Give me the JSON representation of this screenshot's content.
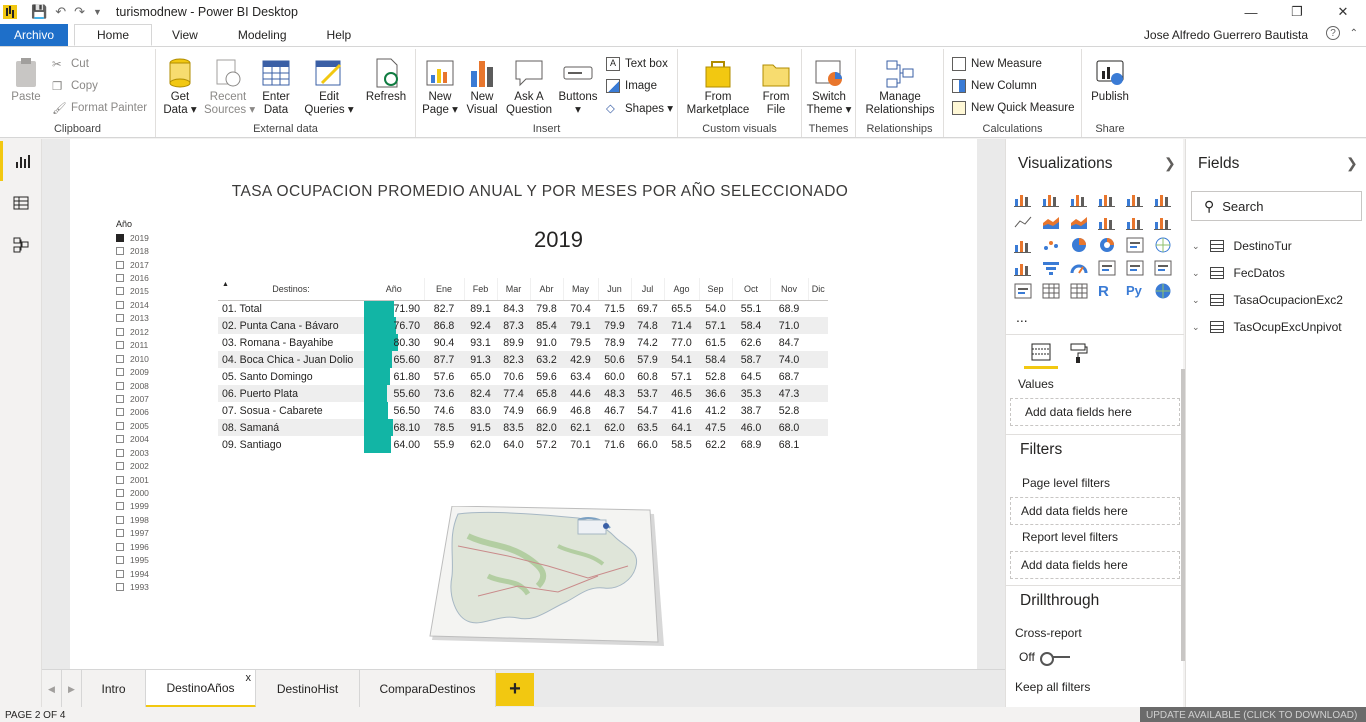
{
  "app": {
    "title": "turismodnew - Power BI Desktop",
    "user": "Jose Alfredo Guerrero Bautista",
    "help": "?"
  },
  "menu_tabs": [
    "Archivo",
    "Home",
    "View",
    "Modeling",
    "Help"
  ],
  "ribbon": {
    "clipboard": {
      "paste": "Paste",
      "cut": "Cut",
      "copy": "Copy",
      "format_painter": "Format Painter",
      "label": "Clipboard"
    },
    "external": {
      "get_data": "Get\nData ▾",
      "recent": "Recent\nSources ▾",
      "enter": "Enter\nData",
      "edit": "Edit\nQueries ▾",
      "refresh": "Refresh",
      "label": "External data"
    },
    "insert": {
      "new_page": "New\nPage ▾",
      "new_visual": "New\nVisual",
      "ask": "Ask A\nQuestion",
      "buttons": "Buttons\n▾",
      "text_box": "Text box",
      "image": "Image",
      "shapes": "Shapes ▾",
      "label": "Insert"
    },
    "custom": {
      "from_market": "From\nMarketplace",
      "from_file": "From\nFile",
      "label": "Custom visuals"
    },
    "themes": {
      "switch": "Switch\nTheme ▾",
      "label": "Themes"
    },
    "relationships": {
      "manage": "Manage\nRelationships",
      "label": "Relationships"
    },
    "calculations": {
      "new_measure": "New Measure",
      "new_column": "New Column",
      "new_quick": "New Quick Measure",
      "label": "Calculations"
    },
    "share": {
      "publish": "Publish",
      "label": "Share"
    }
  },
  "report": {
    "title": "TASA OCUPACION PROMEDIO ANUAL Y POR MESES POR AÑO SELECCIONADO",
    "selected_year": "2019",
    "slicer_header": "Año",
    "years": [
      "2019",
      "2018",
      "2017",
      "2016",
      "2015",
      "2014",
      "2013",
      "2012",
      "2011",
      "2010",
      "2009",
      "2008",
      "2007",
      "2006",
      "2005",
      "2004",
      "2003",
      "2002",
      "2001",
      "2000",
      "1999",
      "1998",
      "1997",
      "1996",
      "1995",
      "1994",
      "1993"
    ],
    "table": {
      "columns": [
        "Destinos:",
        "Año",
        "Ene",
        "Feb",
        "Mar",
        "Abr",
        "May",
        "Jun",
        "Jul",
        "Ago",
        "Sep",
        "Oct",
        "Nov",
        "Dic"
      ],
      "rows": [
        {
          "dest": "01. Total",
          "ano": "71.90",
          "ano_value": 71.9,
          "m": [
            "82.7",
            "89.1",
            "84.3",
            "79.8",
            "70.4",
            "71.5",
            "69.7",
            "65.5",
            "54.0",
            "55.1",
            "68.9",
            ""
          ]
        },
        {
          "dest": "02. Punta Cana - Bávaro",
          "ano": "76.70",
          "ano_value": 76.7,
          "m": [
            "86.8",
            "92.4",
            "87.3",
            "85.4",
            "79.1",
            "79.9",
            "74.8",
            "71.4",
            "57.1",
            "58.4",
            "71.0",
            ""
          ]
        },
        {
          "dest": "03. Romana - Bayahibe",
          "ano": "80.30",
          "ano_value": 80.3,
          "m": [
            "90.4",
            "93.1",
            "89.9",
            "91.0",
            "79.5",
            "78.9",
            "74.2",
            "77.0",
            "61.5",
            "62.6",
            "84.7",
            ""
          ]
        },
        {
          "dest": "04. Boca Chica - Juan Dolio",
          "ano": "65.60",
          "ano_value": 65.6,
          "m": [
            "87.7",
            "91.3",
            "82.3",
            "63.2",
            "42.9",
            "50.6",
            "57.9",
            "54.1",
            "58.4",
            "58.7",
            "74.0",
            ""
          ]
        },
        {
          "dest": "05. Santo Domingo",
          "ano": "61.80",
          "ano_value": 61.8,
          "m": [
            "57.6",
            "65.0",
            "70.6",
            "59.6",
            "63.4",
            "60.0",
            "60.8",
            "57.1",
            "52.8",
            "64.5",
            "68.7",
            ""
          ]
        },
        {
          "dest": "06. Puerto Plata",
          "ano": "55.60",
          "ano_value": 55.6,
          "m": [
            "73.6",
            "82.4",
            "77.4",
            "65.8",
            "44.6",
            "48.3",
            "53.7",
            "46.5",
            "36.6",
            "35.3",
            "47.3",
            ""
          ]
        },
        {
          "dest": "07. Sosua - Cabarete",
          "ano": "56.50",
          "ano_value": 56.5,
          "m": [
            "74.6",
            "83.0",
            "74.9",
            "66.9",
            "46.8",
            "46.7",
            "54.7",
            "41.6",
            "41.2",
            "38.7",
            "52.8",
            ""
          ]
        },
        {
          "dest": "08. Samaná",
          "ano": "68.10",
          "ano_value": 68.1,
          "m": [
            "78.5",
            "91.5",
            "83.5",
            "82.0",
            "62.1",
            "62.0",
            "63.5",
            "64.1",
            "47.5",
            "46.0",
            "68.0",
            ""
          ]
        },
        {
          "dest": "09. Santiago",
          "ano": "64.00",
          "ano_value": 64.0,
          "m": [
            "55.9",
            "62.0",
            "64.0",
            "57.2",
            "70.1",
            "71.6",
            "66.0",
            "58.5",
            "62.2",
            "68.9",
            "68.1",
            ""
          ]
        }
      ]
    }
  },
  "pages": {
    "tabs": [
      "Intro",
      "DestinoAños",
      "DestinoHist",
      "ComparaDestinos"
    ],
    "active": "DestinoAños",
    "close": "x",
    "add": "+",
    "status": "PAGE 2 OF 4",
    "update": "UPDATE AVAILABLE (CLICK TO DOWNLOAD)"
  },
  "visualizations": {
    "title": "Visualizations",
    "more": "...",
    "values_label": "Values",
    "add_fields": "Add data fields here",
    "filters_title": "Filters",
    "page_filters": "Page level filters",
    "report_filters": "Report level filters",
    "drill_title": "Drillthrough",
    "cross_report": "Cross-report",
    "off": "Off",
    "keep_filters": "Keep all filters"
  },
  "fields": {
    "title": "Fields",
    "search_placeholder": "Search",
    "tables": [
      "DestinoTur",
      "FecDatos",
      "TasaOcupacionExc2",
      "TasOcupExcUnpivot"
    ]
  },
  "colors": {
    "accent": "#f2c811",
    "bar": "#12b5a5",
    "file_tab": "#1e6fc9"
  }
}
